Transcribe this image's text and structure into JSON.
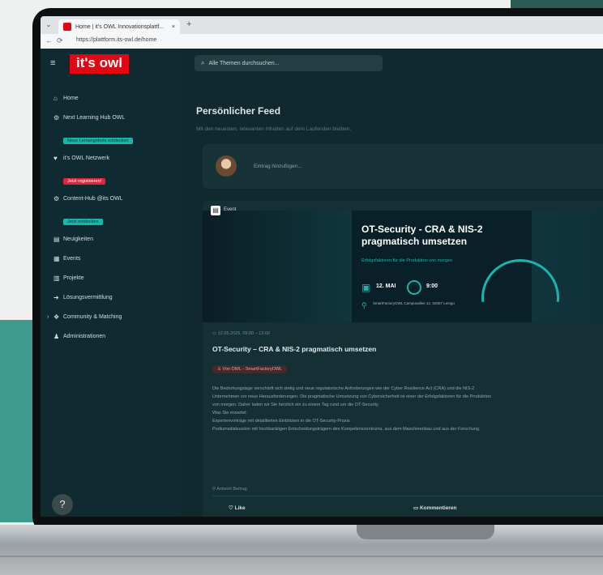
{
  "browser": {
    "tab_title": "Home | it's OWL Innovationsplattf...",
    "tab_close": "×",
    "new_tab": "+",
    "url": "https://plattform.its-owl.de/home"
  },
  "sidebar": {
    "logo": "it's owl",
    "items": [
      {
        "label": "Home",
        "icon": "home-icon"
      },
      {
        "label": "Next Learning Hub OWL",
        "icon": "gear-icon",
        "badge": "Neue Lernangebote entdecken",
        "badge_color": "#19b5ad"
      },
      {
        "label": "it's OWL Netzwerk",
        "icon": "heart-icon",
        "badge": "Jetzt registrieren!",
        "badge_color": "#e3253a"
      },
      {
        "label": "Content-Hub @its OWL",
        "icon": "gear-icon",
        "badge": "Jetzt entdecken",
        "badge_color": "#19b5ad"
      },
      {
        "label": "Neuigkeiten",
        "icon": "news-icon"
      },
      {
        "label": "Events",
        "icon": "calendar-icon"
      },
      {
        "label": "Projekte",
        "icon": "projects-icon"
      },
      {
        "label": "Lösungsvermittlung",
        "icon": "solutions-icon"
      },
      {
        "label": "Community & Matching",
        "icon": "community-icon"
      },
      {
        "label": "Administrationen",
        "icon": "admin-icon"
      }
    ],
    "help": "?"
  },
  "header": {
    "search_placeholder": "Alle Themen durchsuchen..."
  },
  "feed": {
    "title": "Persönlicher Feed",
    "subtitle": "Mit den neuesten, relevanten Inhalten auf dem Laufenden bleiben.",
    "post_placeholder": "Eintrag hinzufügen..."
  },
  "card": {
    "category": "Event",
    "hero_title": "OT-Security - CRA & NIS-2 pragmatisch umsetzen",
    "hero_subtitle": "Erfolgsfaktoren für die Produktion von morgen",
    "hero_date": "12. MAI",
    "hero_time": "9:00",
    "hero_location": "SmartFactoryOWL Campusallee 12, 32657 Lemgo",
    "meta": "12.05.2025, 09:00 – 13:00",
    "title": "OT-Security – CRA & NIS-2 pragmatisch umsetzen",
    "tag": "Von OWL - SmartFactoryOWL",
    "body": [
      "Die Bedrohungslage verschärft sich stetig und neue regulatorische Anforderungen wie der Cyber Resilience Act (CRA) und die NIS-2",
      "Unternehmen vor neue Herausforderungen. Die pragmatische Umsetzung von Cybersicherheit ist einer der Erfolgsfaktoren für die Produktion",
      "von morgen. Daher laden wir Sie herzlich ein zu einem Tag rund um die OT-Security.",
      "Was Sie erwartet:",
      "Expertenvorträge mit detaillierten Einblicken in die OT-Security-Praxis",
      "Podiumsdiskussion mit hochkarätigen Entscheidungsträgern des Kompetenzzentrums, aus dem Maschinenbau und aus der Forschung"
    ],
    "answer": "Antwort Beitrag",
    "like": "Like",
    "comment": "Kommentieren"
  }
}
